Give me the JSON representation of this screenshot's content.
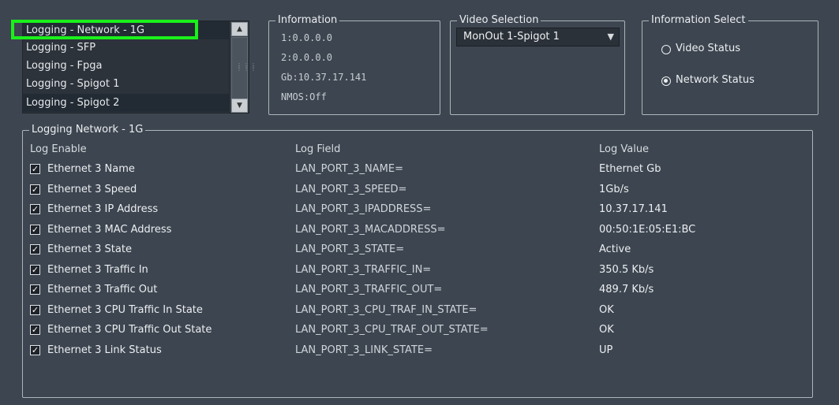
{
  "log_list": {
    "items": [
      {
        "label": "Logging - Network - 1G",
        "selected": true
      },
      {
        "label": "Logging - SFP",
        "selected": false
      },
      {
        "label": "Logging - Fpga",
        "selected": false
      },
      {
        "label": "Logging - Spigot 1",
        "selected": false
      },
      {
        "label": "Logging - Spigot 2",
        "selected": false
      }
    ]
  },
  "information": {
    "title": "Information",
    "lines": [
      "1:0.0.0.0",
      "2:0.0.0.0",
      "Gb:10.37.17.141",
      "NMOS:Off"
    ]
  },
  "video_selection": {
    "title": "Video Selection",
    "value": "MonOut 1-Spigot 1"
  },
  "information_select": {
    "title": "Information Select",
    "options": [
      {
        "label": "Video Status",
        "selected": false
      },
      {
        "label": "Network Status",
        "selected": true
      }
    ]
  },
  "logging_panel": {
    "title": "Logging Network - 1G",
    "headers": {
      "enable": "Log Enable",
      "field": "Log Field",
      "value": "Log Value"
    },
    "rows": [
      {
        "name": "Ethernet 3 Name",
        "field": "LAN_PORT_3_NAME=",
        "value": "Ethernet Gb",
        "checked": true
      },
      {
        "name": "Ethernet 3 Speed",
        "field": "LAN_PORT_3_SPEED=",
        "value": "1Gb/s",
        "checked": true
      },
      {
        "name": "Ethernet 3 IP Address",
        "field": "LAN_PORT_3_IPADDRESS=",
        "value": "10.37.17.141",
        "checked": true
      },
      {
        "name": "Ethernet 3 MAC Address",
        "field": "LAN_PORT_3_MACADDRESS=",
        "value": "00:50:1E:05:E1:BC",
        "checked": true
      },
      {
        "name": "Ethernet 3 State",
        "field": "LAN_PORT_3_STATE=",
        "value": "Active",
        "checked": true
      },
      {
        "name": "Ethernet 3 Traffic In",
        "field": "LAN_PORT_3_TRAFFIC_IN=",
        "value": "350.5 Kb/s",
        "checked": true
      },
      {
        "name": "Ethernet 3 Traffic Out",
        "field": "LAN_PORT_3_TRAFFIC_OUT=",
        "value": "489.7 Kb/s",
        "checked": true
      },
      {
        "name": "Ethernet 3 CPU Traffic In State",
        "field": "LAN_PORT_3_CPU_TRAF_IN_STATE=",
        "value": "OK",
        "checked": true
      },
      {
        "name": "Ethernet 3 CPU Traffic Out State",
        "field": "LAN_PORT_3_CPU_TRAF_OUT_STATE=",
        "value": "OK",
        "checked": true
      },
      {
        "name": "Ethernet 3 Link Status",
        "field": "LAN_PORT_3_LINK_STATE=",
        "value": "UP",
        "checked": true
      }
    ]
  },
  "colors": {
    "background": "#3d4550",
    "highlight": "#1af01a",
    "selected_row": "#222a33"
  }
}
